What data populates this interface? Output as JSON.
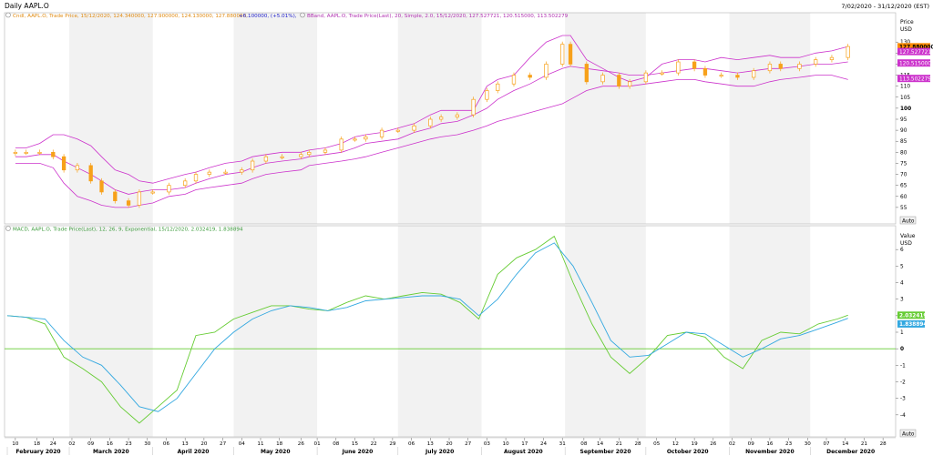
{
  "window": {
    "title": "Daily AAPL.O",
    "date_range": "7/02/2020 - 31/12/2020 (EST)"
  },
  "colors": {
    "candle": "#f7a11a",
    "bband": "#cc33cc",
    "macd": "#66cc33",
    "signal": "#33a8e0",
    "grid_band": "#f2f2f2",
    "price_tag": "#ff8c00"
  },
  "price_panel": {
    "legend_cndl": "Cndl, AAPL.O, Trade Price, 15/12/2020, 124.340000, 127.900000, 124.130000, 127.880000,",
    "legend_change": "+6.100000, (+5.01%),",
    "legend_bband": "BBand, AAPL.O, Trade Price(Last), 20, Simple, 2.0, 15/12/2020, 127.527721, 120.515000, 113.502279",
    "axis_title": "Price",
    "axis_unit": "USD",
    "auto_button": "Auto",
    "last_price": "127.880000",
    "bb_upper_tag": "127.527721",
    "bb_mid_tag": "120.515000",
    "bb_lower_tag": "113.502279"
  },
  "macd_panel": {
    "legend": "MACD, AAPL.O, Trade Price(Last), 12, 26, 9, Exponential, 15/12/2020, 2.032419, 1.838894",
    "axis_title": "Value",
    "axis_unit": "USD",
    "auto_button": "Auto",
    "macd_tag": "2.032419",
    "signal_tag": "1.838894"
  },
  "chart_data": [
    {
      "type": "candlestick",
      "title": "Daily AAPL.O",
      "ylabel": "Price USD",
      "ylim": [
        50,
        140
      ],
      "yticks": [
        55,
        60,
        65,
        70,
        75,
        80,
        85,
        90,
        95,
        100,
        105,
        110,
        115,
        120,
        125,
        130
      ],
      "grid": "alternating month bands",
      "x": [
        "2020-02-10",
        "2020-02-14",
        "2020-02-19",
        "2020-02-24",
        "2020-02-28",
        "2020-03-04",
        "2020-03-09",
        "2020-03-13",
        "2020-03-18",
        "2020-03-23",
        "2020-03-27",
        "2020-04-01",
        "2020-04-07",
        "2020-04-13",
        "2020-04-17",
        "2020-04-22",
        "2020-04-28",
        "2020-05-04",
        "2020-05-08",
        "2020-05-13",
        "2020-05-19",
        "2020-05-26",
        "2020-05-29",
        "2020-06-04",
        "2020-06-10",
        "2020-06-15",
        "2020-06-19",
        "2020-06-25",
        "2020-07-01",
        "2020-07-07",
        "2020-07-13",
        "2020-07-17",
        "2020-07-23",
        "2020-07-29",
        "2020-08-03",
        "2020-08-07",
        "2020-08-13",
        "2020-08-19",
        "2020-08-25",
        "2020-08-31",
        "2020-09-03",
        "2020-09-09",
        "2020-09-15",
        "2020-09-21",
        "2020-09-25",
        "2020-10-01",
        "2020-10-07",
        "2020-10-13",
        "2020-10-19",
        "2020-10-23",
        "2020-10-29",
        "2020-11-04",
        "2020-11-10",
        "2020-11-16",
        "2020-11-20",
        "2020-11-27",
        "2020-12-03",
        "2020-12-09",
        "2020-12-15"
      ],
      "series": [
        {
          "name": "Cndl",
          "field": "close",
          "values": [
            80,
            80,
            80,
            78,
            72,
            74,
            67,
            62,
            58,
            56,
            62,
            62,
            65,
            67,
            70,
            71,
            71,
            72,
            76,
            78,
            78,
            79,
            80,
            81,
            86,
            86,
            87,
            90,
            90,
            92,
            95,
            96,
            97,
            104,
            108,
            111,
            115,
            114,
            120,
            129,
            120,
            112,
            115,
            110,
            112,
            116,
            116,
            121,
            118,
            115,
            115,
            114,
            117,
            120,
            118,
            120,
            122,
            123,
            128
          ]
        },
        {
          "name": "BBand upper",
          "values": [
            82,
            82,
            84,
            88,
            88,
            86,
            83,
            78,
            72,
            70,
            67,
            66,
            68,
            70,
            71,
            73,
            75,
            76,
            78,
            79,
            80,
            80,
            81,
            82,
            84,
            87,
            88,
            89,
            91,
            93,
            97,
            99,
            99,
            99,
            110,
            113,
            115,
            123,
            130,
            133,
            133,
            122,
            118,
            114,
            112,
            114,
            120,
            122,
            122,
            121,
            123,
            122,
            123,
            124,
            123,
            123,
            125,
            126,
            128
          ]
        },
        {
          "name": "BBand middle",
          "values": [
            78,
            78,
            79,
            79,
            76,
            73,
            70,
            67,
            63,
            61,
            62,
            63,
            63,
            64,
            66,
            68,
            70,
            71,
            73,
            75,
            76,
            77,
            78,
            79,
            80,
            82,
            84,
            85,
            86,
            89,
            91,
            93,
            94,
            97,
            100,
            104,
            108,
            111,
            115,
            118,
            119,
            118,
            117,
            116,
            115,
            115,
            116,
            117,
            118,
            118,
            117,
            116,
            117,
            118,
            118,
            119,
            120,
            120,
            121
          ]
        },
        {
          "name": "BBand lower",
          "values": [
            75,
            75,
            75,
            73,
            66,
            60,
            58,
            56,
            55,
            55,
            56,
            57,
            60,
            61,
            63,
            64,
            65,
            66,
            68,
            70,
            71,
            72,
            74,
            75,
            76,
            77,
            78,
            80,
            82,
            84,
            86,
            87,
            88,
            90,
            92,
            94,
            96,
            98,
            100,
            102,
            104,
            108,
            110,
            110,
            110,
            111,
            112,
            113,
            113,
            112,
            111,
            110,
            110,
            112,
            113,
            114,
            115,
            115,
            113
          ]
        }
      ]
    },
    {
      "type": "line",
      "title": "MACD",
      "ylabel": "Value USD",
      "ylim": [
        -5,
        7
      ],
      "yticks": [
        -4,
        -3,
        -2,
        -1,
        0,
        1,
        2,
        3,
        4,
        5,
        6
      ],
      "x": [
        "2020-02-07",
        "2020-02-14",
        "2020-02-21",
        "2020-02-28",
        "2020-03-06",
        "2020-03-13",
        "2020-03-20",
        "2020-03-27",
        "2020-04-03",
        "2020-04-10",
        "2020-04-17",
        "2020-04-24",
        "2020-05-01",
        "2020-05-08",
        "2020-05-15",
        "2020-05-22",
        "2020-05-29",
        "2020-06-05",
        "2020-06-12",
        "2020-06-19",
        "2020-06-26",
        "2020-07-03",
        "2020-07-10",
        "2020-07-17",
        "2020-07-24",
        "2020-07-31",
        "2020-08-07",
        "2020-08-14",
        "2020-08-21",
        "2020-08-28",
        "2020-09-04",
        "2020-09-11",
        "2020-09-18",
        "2020-09-25",
        "2020-10-02",
        "2020-10-09",
        "2020-10-16",
        "2020-10-23",
        "2020-10-30",
        "2020-11-06",
        "2020-11-13",
        "2020-11-20",
        "2020-11-27",
        "2020-12-04",
        "2020-12-11",
        "2020-12-15"
      ],
      "series": [
        {
          "name": "MACD",
          "values": [
            2.0,
            1.9,
            1.5,
            -0.5,
            -1.2,
            -2.0,
            -3.5,
            -4.5,
            -3.5,
            -2.5,
            0.8,
            1.0,
            1.8,
            2.2,
            2.6,
            2.6,
            2.4,
            2.3,
            2.8,
            3.2,
            3.0,
            3.2,
            3.4,
            3.3,
            2.8,
            1.8,
            4.5,
            5.5,
            6.0,
            6.8,
            4.0,
            1.5,
            -0.5,
            -1.5,
            -0.5,
            0.8,
            1.0,
            0.7,
            -0.5,
            -1.2,
            0.5,
            1.0,
            0.9,
            1.5,
            1.8,
            2.03
          ]
        },
        {
          "name": "Signal",
          "values": [
            2.0,
            1.9,
            1.8,
            0.5,
            -0.5,
            -1.0,
            -2.2,
            -3.5,
            -3.8,
            -3.0,
            -1.5,
            0.0,
            1.0,
            1.8,
            2.3,
            2.6,
            2.5,
            2.3,
            2.5,
            2.9,
            3.0,
            3.1,
            3.2,
            3.2,
            3.0,
            2.0,
            3.0,
            4.5,
            5.8,
            6.4,
            5.0,
            2.8,
            0.5,
            -0.5,
            -0.4,
            0.3,
            1.0,
            0.9,
            0.2,
            -0.5,
            0.0,
            0.6,
            0.8,
            1.2,
            1.6,
            1.84
          ]
        }
      ]
    }
  ],
  "x_axis": {
    "day_ticks": [
      "10",
      "18",
      "24",
      "02",
      "09",
      "16",
      "23",
      "30",
      "06",
      "13",
      "20",
      "27",
      "04",
      "11",
      "18",
      "26",
      "01",
      "08",
      "15",
      "22",
      "29",
      "06",
      "13",
      "20",
      "27",
      "03",
      "10",
      "17",
      "24",
      "31",
      "08",
      "14",
      "21",
      "28",
      "05",
      "12",
      "19",
      "26",
      "02",
      "09",
      "16",
      "23",
      "30",
      "07",
      "14",
      "21",
      "28"
    ],
    "months": [
      "February 2020",
      "March 2020",
      "April 2020",
      "May 2020",
      "June 2020",
      "July 2020",
      "August 2020",
      "September 2020",
      "October 2020",
      "November 2020",
      "December 2020"
    ]
  }
}
